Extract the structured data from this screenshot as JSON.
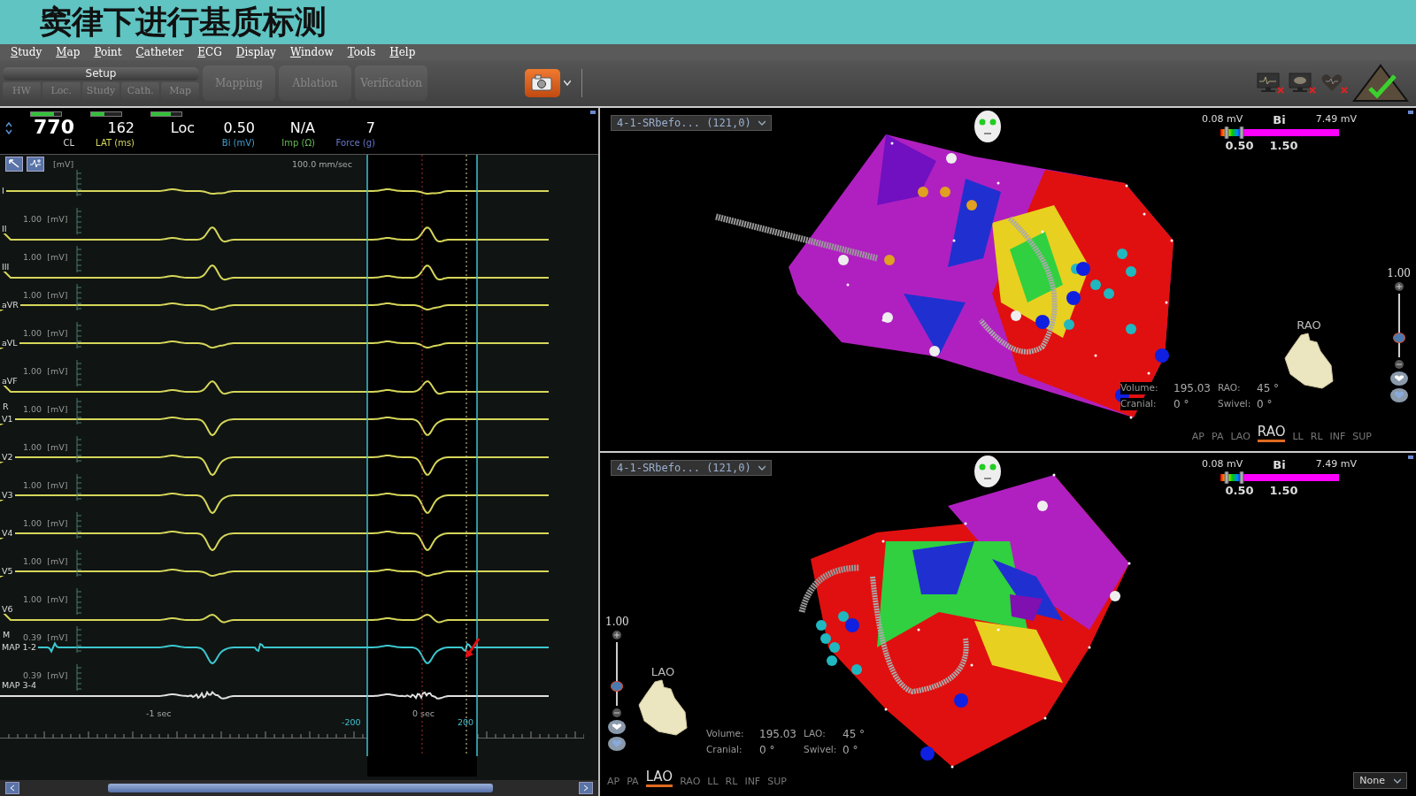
{
  "slide_title": "窦律下进行基质标测",
  "menu": [
    "Study",
    "Map",
    "Point",
    "Catheter",
    "ECG",
    "Display",
    "Window",
    "Tools",
    "Help"
  ],
  "toolbar": {
    "setup_label": "Setup",
    "setup_tabs": [
      "HW",
      "Loc.",
      "Study",
      "Cath.",
      "Map"
    ],
    "modes": [
      "Mapping",
      "Ablation",
      "Verification"
    ]
  },
  "info_bar": [
    {
      "value": "770",
      "label": "CL",
      "color": "#dddddd",
      "level": 0.75,
      "kind": "large"
    },
    {
      "value": "162",
      "label": "LAT (ms)",
      "color": "#d8d860",
      "level": 0.45,
      "kind": "normal"
    },
    {
      "value": "Loc",
      "level": 0.65,
      "kind": "normal"
    },
    {
      "value": "0.50",
      "label": "Bi (mV)",
      "color": "#3f9fcf",
      "kind": "normal"
    },
    {
      "value": "N/A",
      "label": "Imp (Ω)",
      "color": "#66bb55",
      "kind": "normal"
    },
    {
      "value": "7",
      "label": "Force (g)",
      "color": "#6677cc",
      "kind": "normal"
    }
  ],
  "ecg": {
    "speed": "100.0 mm/sec",
    "channels": [
      {
        "name": "I",
        "gain": "[mV]",
        "color": "#d6d65a"
      },
      {
        "name": "II",
        "gain": "1.00  [mV]",
        "color": "#d6d65a"
      },
      {
        "name": "III",
        "gain": "1.00  [mV]",
        "color": "#d6d65a"
      },
      {
        "name": "aVR",
        "gain": "1.00  [mV]",
        "color": "#d6d65a"
      },
      {
        "name": "aVL",
        "gain": "1.00  [mV]",
        "color": "#d6d65a"
      },
      {
        "name": "aVF",
        "gain": "1.00  [mV]",
        "color": "#d6d65a"
      },
      {
        "name": "V1",
        "group": "R",
        "gain": "1.00  [mV]",
        "color": "#d6d65a"
      },
      {
        "name": "V2",
        "gain": "1.00  [mV]",
        "color": "#d6d65a"
      },
      {
        "name": "V3",
        "gain": "1.00  [mV]",
        "color": "#d6d65a"
      },
      {
        "name": "V4",
        "gain": "1.00  [mV]",
        "color": "#d6d65a"
      },
      {
        "name": "V5",
        "gain": "1.00  [mV]",
        "color": "#d6d65a"
      },
      {
        "name": "V6",
        "gain": "1.00  [mV]",
        "color": "#d6d65a"
      },
      {
        "name": "MAP 1-2",
        "group": "M",
        "gain": "0.39  [mV]",
        "color": "#3cc8d0"
      },
      {
        "name": "MAP 3-4",
        "gain": "0.39  [mV]",
        "color": "#e0e0e0"
      }
    ],
    "time_labels": [
      {
        "text": "-1 sec",
        "kind": "time"
      },
      {
        "text": "-200",
        "kind": "cursor"
      },
      {
        "text": "0 sec",
        "kind": "time"
      },
      {
        "text": "200",
        "kind": "cursor"
      }
    ]
  },
  "views": [
    {
      "kind": "right",
      "dropdown": "4-1-SRbefo... (121,0)",
      "colorbar": {
        "min": "0.08 mV",
        "type": "Bi",
        "max": "7.49 mV",
        "low": "0.50",
        "high": "1.50"
      },
      "zoom": {
        "value": "1.00",
        "level": 0.3
      },
      "orientation": "RAO",
      "stats": [
        {
          "label": "Volume:",
          "value": "195.03"
        },
        {
          "label": "RAO:",
          "value": "45 °"
        },
        {
          "label": "Cranial:",
          "value": "0 °"
        },
        {
          "label": "Swivel:",
          "value": "0 °"
        }
      ],
      "view_tabs": [
        {
          "label": "AP",
          "selected": false
        },
        {
          "label": "PA",
          "selected": false
        },
        {
          "label": "LAO",
          "selected": false
        },
        {
          "label": "RAO",
          "selected": true
        },
        {
          "label": "LL",
          "selected": false
        },
        {
          "label": "RL",
          "selected": false
        },
        {
          "label": "INF",
          "selected": false
        },
        {
          "label": "SUP",
          "selected": false
        }
      ]
    },
    {
      "kind": "left",
      "dropdown": "4-1-SRbefo... (121,0)",
      "colorbar": {
        "min": "0.08 mV",
        "type": "Bi",
        "max": "7.49 mV",
        "low": "0.50",
        "high": "1.50"
      },
      "zoom": {
        "value": "1.00",
        "level": 0.3
      },
      "orientation": "LAO",
      "stats": [
        {
          "label": "Volume:",
          "value": "195.03"
        },
        {
          "label": "LAO:",
          "value": "45 °"
        },
        {
          "label": "Cranial:",
          "value": "0 °"
        },
        {
          "label": "Swivel:",
          "value": "0 °"
        }
      ],
      "view_tabs": [
        {
          "label": "AP",
          "selected": false
        },
        {
          "label": "PA",
          "selected": false
        },
        {
          "label": "LAO",
          "selected": true
        },
        {
          "label": "RAO",
          "selected": false
        },
        {
          "label": "LL",
          "selected": false
        },
        {
          "label": "RL",
          "selected": false
        },
        {
          "label": "INF",
          "selected": false
        },
        {
          "label": "SUP",
          "selected": false
        }
      ],
      "filter": "None"
    }
  ]
}
